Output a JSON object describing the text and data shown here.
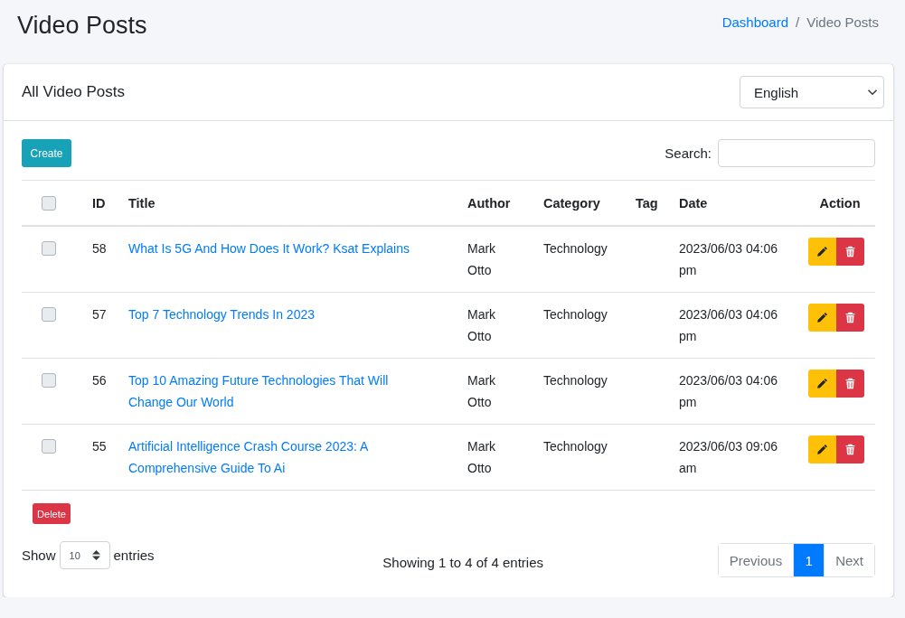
{
  "page_title": "Video Posts",
  "breadcrumb": [
    {
      "label": "Dashboard",
      "kind": "link"
    },
    {
      "label": "/",
      "kind": "separator"
    },
    {
      "label": "Video Posts",
      "kind": "current"
    }
  ],
  "card": {
    "title": "All Video Posts",
    "language_select": {
      "value": "English"
    }
  },
  "toolbar": {
    "create_button": "Create",
    "search_label": "Search:"
  },
  "table": {
    "select_all": {
      "checked": false
    },
    "columns": [
      "ID",
      "Title",
      "Author",
      "Category",
      "Tag",
      "Date",
      "Action"
    ],
    "rows": [
      {
        "checked": false,
        "id": "58",
        "title": "What Is 5G And How Does It Work? Ksat Explains",
        "author": "Mark Otto",
        "category": "Technology",
        "date": "2023/06/03 04:06 pm"
      },
      {
        "checked": false,
        "id": "57",
        "title": "Top 7 Technology Trends In 2023",
        "author": "Mark Otto",
        "category": "Technology",
        "date": "2023/06/03 04:06 pm"
      },
      {
        "checked": false,
        "id": "56",
        "title": "Top 10 Amazing Future Technologies That Will Change Our World",
        "author": "Mark Otto",
        "category": "Technology",
        "date": "2023/06/03 04:06 pm"
      },
      {
        "checked": false,
        "id": "55",
        "title": "Artificial Intelligence Crash Course 2023: A Comprehensive Guide To Ai",
        "author": "Mark Otto",
        "category": "Technology",
        "date": "2023/06/03 09:06 am"
      }
    ]
  },
  "delete_button": "Delete",
  "length_menu": {
    "label_before": "Show",
    "value": "10",
    "label_after": "entries"
  },
  "info": "Showing 1 to 4 of 4 entries",
  "pagination": {
    "previous": {
      "label": "Previous",
      "disabled": true
    },
    "pages": [
      {
        "label": "1",
        "selected": true
      }
    ],
    "next": {
      "label": "Next",
      "disabled": true
    }
  }
}
